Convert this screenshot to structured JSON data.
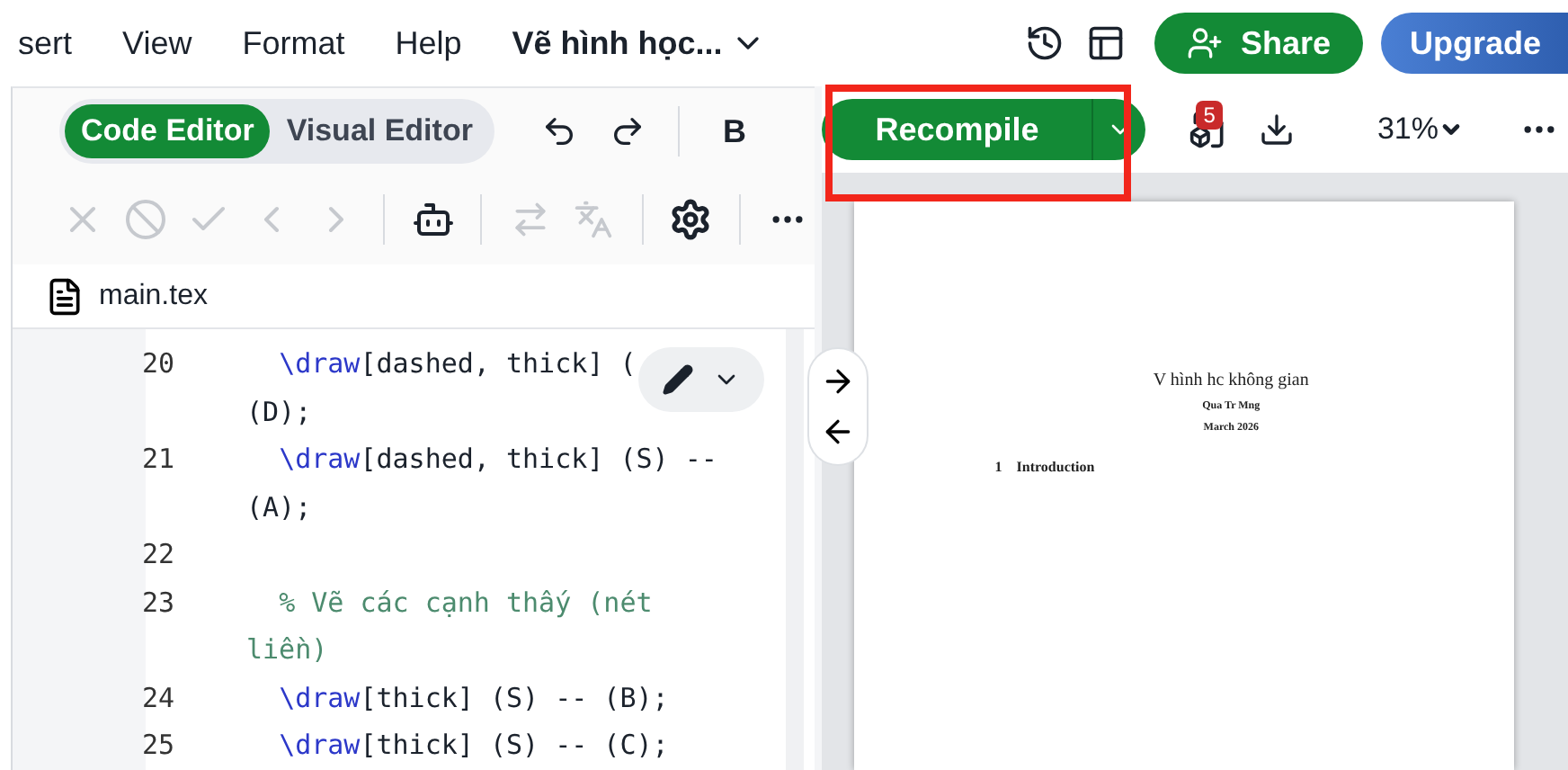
{
  "menu": [
    {
      "label": "sert"
    },
    {
      "label": "View"
    },
    {
      "label": "Format"
    },
    {
      "label": "Help"
    }
  ],
  "project_title": "Vẽ hình học...",
  "share_button": "Share",
  "upgrade_button": "Upgrade",
  "editor_modes": [
    {
      "label": "Code Editor",
      "selected": true
    },
    {
      "label": "Visual Editor",
      "selected": false
    }
  ],
  "bold_button": "B",
  "recompile_button": "Recompile",
  "log_badge": "5",
  "zoom": "31%",
  "file_tab": "main.tex",
  "code_lines": [
    {
      "number": "20",
      "kind": "code",
      "command": "\\draw",
      "rest": "[dashed, thick] (",
      "continuation": "(D);"
    },
    {
      "number": "21",
      "kind": "code",
      "command": "\\draw",
      "rest": "[dashed, thick] (S) --",
      "continuation": "(A);"
    },
    {
      "number": "22",
      "kind": "blank"
    },
    {
      "number": "23",
      "kind": "comment",
      "rest": "% Vẽ các cạnh thấy (nét",
      "continuation": "liền)"
    },
    {
      "number": "24",
      "kind": "code",
      "command": "\\draw",
      "rest": "[thick] (S) -- (B);"
    },
    {
      "number": "25",
      "kind": "code",
      "command": "\\draw",
      "rest": "[thick] (S) -- (C);"
    }
  ],
  "pdf_page": {
    "title": "V hình hc không gian",
    "author": "Qua Tr Mng",
    "date": "March 2026",
    "section_number": "1",
    "section_title": "Introduction"
  }
}
